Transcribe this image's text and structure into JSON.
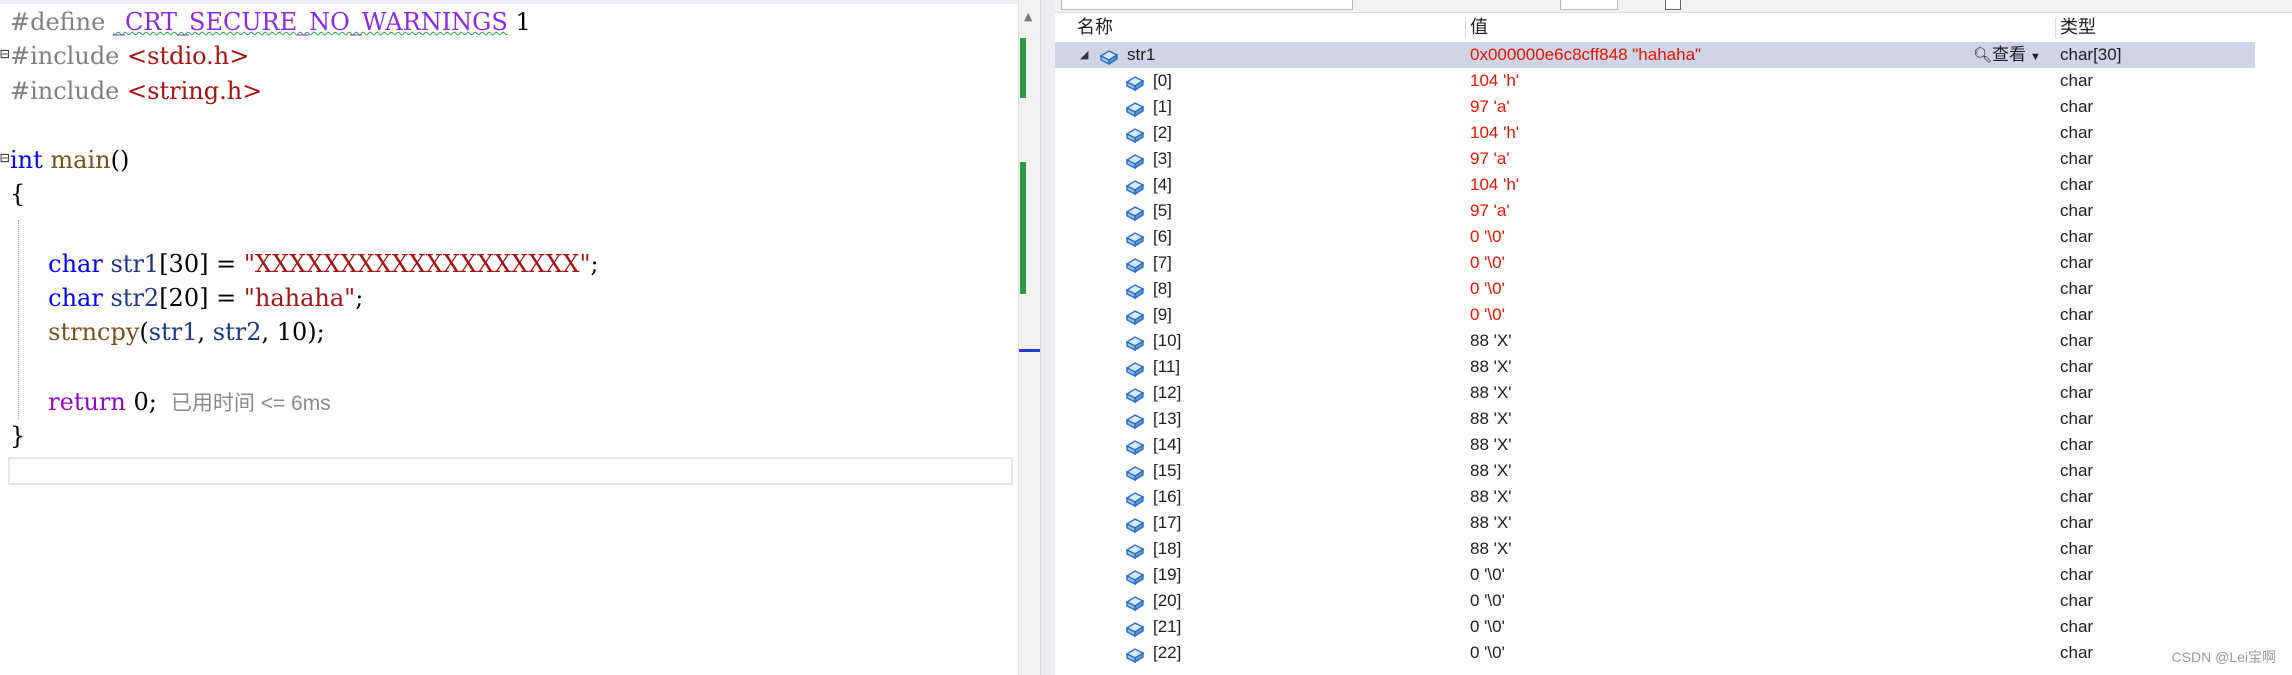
{
  "editor": {
    "lines": {
      "define_kw": "#define",
      "define_name": "_CRT_SECURE_NO_WARNINGS",
      "define_val": "1",
      "inc1_kw": "#include",
      "inc1_file": "<stdio.h>",
      "inc2_kw": "#include",
      "inc2_file": "<string.h>",
      "main_type": "int",
      "main_name": "main",
      "main_parens": "()",
      "open_brace": "{",
      "decl1_type": "char",
      "decl1_var": "str1",
      "decl1_rest": "[30] = ",
      "decl1_str": "\"XXXXXXXXXXXXXXXXXXX\"",
      "decl1_end": ";",
      "decl2_type": "char",
      "decl2_var": "str2",
      "decl2_rest": "[20] = ",
      "decl2_str": "\"hahaha\"",
      "decl2_end": ";",
      "call_fn": "strncpy",
      "call_open": "(",
      "call_arg1": "str1",
      "call_sep1": ", ",
      "call_arg2": "str2",
      "call_sep2": ", ",
      "call_arg3": "10",
      "call_close": ");",
      "return_kw": "return",
      "return_val": " 0;",
      "perf_tip": "已用时间 <= 6ms",
      "close_brace": "}"
    }
  },
  "watch": {
    "columns": {
      "name": "名称",
      "value": "值",
      "type": "类型"
    },
    "view_button": "查看",
    "rows": [
      {
        "name": "str1",
        "value": "0x000000e6c8cff848 \"hahaha\"",
        "type": "char[30]",
        "changed": true
      },
      {
        "name": "[0]",
        "value": "104 'h'",
        "type": "char",
        "changed": true
      },
      {
        "name": "[1]",
        "value": "97 'a'",
        "type": "char",
        "changed": true
      },
      {
        "name": "[2]",
        "value": "104 'h'",
        "type": "char",
        "changed": true
      },
      {
        "name": "[3]",
        "value": "97 'a'",
        "type": "char",
        "changed": true
      },
      {
        "name": "[4]",
        "value": "104 'h'",
        "type": "char",
        "changed": true
      },
      {
        "name": "[5]",
        "value": "97 'a'",
        "type": "char",
        "changed": true
      },
      {
        "name": "[6]",
        "value": "0 '\\0'",
        "type": "char",
        "changed": true
      },
      {
        "name": "[7]",
        "value": "0 '\\0'",
        "type": "char",
        "changed": true
      },
      {
        "name": "[8]",
        "value": "0 '\\0'",
        "type": "char",
        "changed": true
      },
      {
        "name": "[9]",
        "value": "0 '\\0'",
        "type": "char",
        "changed": true
      },
      {
        "name": "[10]",
        "value": "88 'X'",
        "type": "char",
        "changed": false
      },
      {
        "name": "[11]",
        "value": "88 'X'",
        "type": "char",
        "changed": false
      },
      {
        "name": "[12]",
        "value": "88 'X'",
        "type": "char",
        "changed": false
      },
      {
        "name": "[13]",
        "value": "88 'X'",
        "type": "char",
        "changed": false
      },
      {
        "name": "[14]",
        "value": "88 'X'",
        "type": "char",
        "changed": false
      },
      {
        "name": "[15]",
        "value": "88 'X'",
        "type": "char",
        "changed": false
      },
      {
        "name": "[16]",
        "value": "88 'X'",
        "type": "char",
        "changed": false
      },
      {
        "name": "[17]",
        "value": "88 'X'",
        "type": "char",
        "changed": false
      },
      {
        "name": "[18]",
        "value": "88 'X'",
        "type": "char",
        "changed": false
      },
      {
        "name": "[19]",
        "value": "0 '\\0'",
        "type": "char",
        "changed": false
      },
      {
        "name": "[20]",
        "value": "0 '\\0'",
        "type": "char",
        "changed": false
      },
      {
        "name": "[21]",
        "value": "0 '\\0'",
        "type": "char",
        "changed": false
      },
      {
        "name": "[22]",
        "value": "0 '\\0'",
        "type": "char",
        "changed": false
      }
    ]
  },
  "colors": {
    "changed_value": "#e51400",
    "selected_row": "#cfd5e6",
    "keyword": "#0000ff",
    "string": "#a31515"
  },
  "watermark": "CSDN @Lei宝啊"
}
